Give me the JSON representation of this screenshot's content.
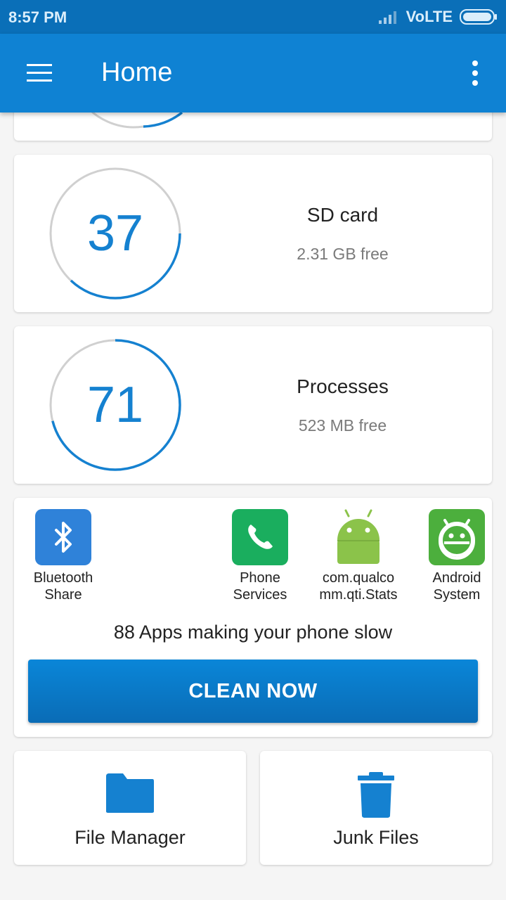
{
  "status": {
    "time": "8:57 PM",
    "network": "VoLTE",
    "icons": [
      "signal-icon",
      "battery-icon"
    ]
  },
  "appbar": {
    "title": "Home",
    "icons": [
      "menu-icon",
      "more-vert-icon"
    ]
  },
  "storage": [
    {
      "number": "37",
      "title": "SD card",
      "subtitle": "2.31 GB free",
      "fill_fraction": 0.37
    },
    {
      "number": "71",
      "title": "Processes",
      "subtitle": "523 MB free",
      "fill_fraction": 0.71
    }
  ],
  "apps": {
    "items": [
      {
        "label": "Bluetooth\nShare",
        "icon": "bluetooth-icon",
        "color": "#2f82d9"
      },
      {
        "label": "Phone\nServices",
        "icon": "phone-icon",
        "color": "#1aae5e"
      },
      {
        "label": "com.qualco\nmm.qti.Stats",
        "icon": "android-icon",
        "color": "#8bc34a"
      },
      {
        "label": "Android\nSystem",
        "icon": "android-system-icon",
        "color": "#4caf3d"
      }
    ],
    "message": "88 Apps making your phone slow",
    "clean_label": "CLEAN NOW"
  },
  "tiles": [
    {
      "label": "File Manager",
      "icon": "folder-icon"
    },
    {
      "label": "Junk Files",
      "icon": "trash-icon"
    }
  ],
  "colors": {
    "accent": "#0f82d3",
    "status_bar": "#0a6fb8",
    "ring_track": "#d0d0d0",
    "ring_fill": "#1581d0"
  }
}
